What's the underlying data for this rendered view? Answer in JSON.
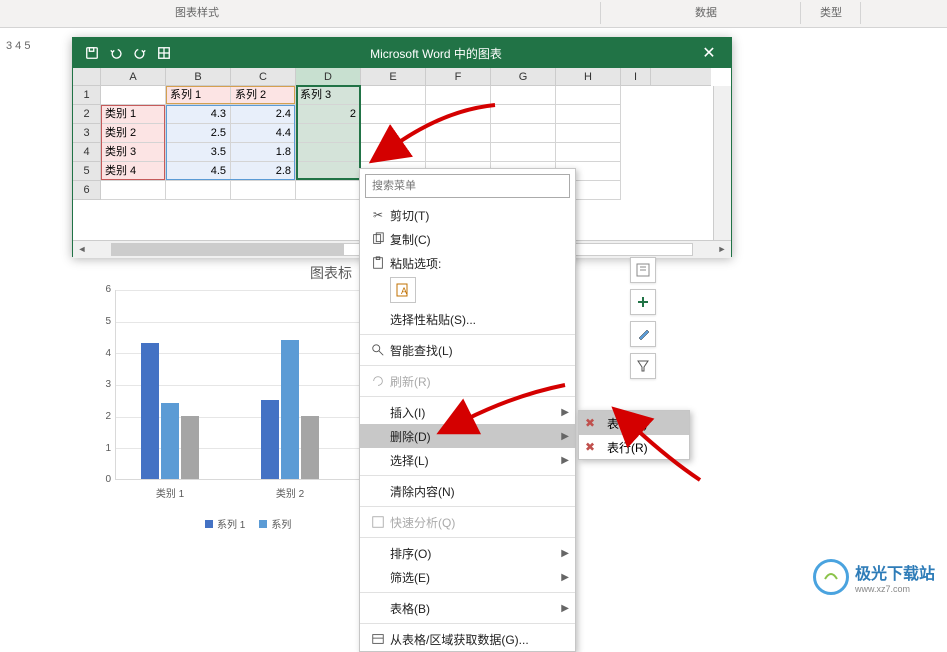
{
  "ribbon": {
    "style_group": "图表样式",
    "data_group": "数据",
    "type_group": "类型"
  },
  "row_tabs": "3     4     5",
  "excel": {
    "title": "Microsoft Word 中的图表",
    "cols": [
      "A",
      "B",
      "C",
      "D",
      "E",
      "F",
      "G",
      "H",
      "I"
    ],
    "rows": [
      "1",
      "2",
      "3",
      "4",
      "5",
      "6"
    ],
    "headers": {
      "s1": "系列 1",
      "s2": "系列 2",
      "s3": "系列 3"
    },
    "cats": {
      "c1": "类别 1",
      "c2": "类别 2",
      "c3": "类别 3",
      "c4": "类别 4"
    },
    "data": {
      "r1": {
        "b": "4.3",
        "c": "2.4",
        "d": "2"
      },
      "r2": {
        "b": "2.5",
        "c": "4.4",
        "d": ""
      },
      "r3": {
        "b": "3.5",
        "c": "1.8",
        "d": ""
      },
      "r4": {
        "b": "4.5",
        "c": "2.8",
        "d": ""
      }
    }
  },
  "chart_title_fragment": "图表标",
  "chart_data": {
    "type": "bar",
    "categories": [
      "类别 1",
      "类别 2",
      "类别 3",
      "类别 4"
    ],
    "series": [
      {
        "name": "系列 1",
        "values": [
          4.3,
          2.5,
          3.5,
          4.5
        ],
        "color": "#4472c4"
      },
      {
        "name": "系列 2",
        "values": [
          2.4,
          4.4,
          1.8,
          2.8
        ],
        "color": "#5b9bd5"
      },
      {
        "name": "系列 3",
        "values": [
          2,
          null,
          null,
          null
        ],
        "color": "#a5a5a5"
      }
    ],
    "ylim": [
      0,
      6
    ],
    "yticks": [
      0,
      1,
      2,
      3,
      4,
      5,
      6
    ],
    "visible_categories": [
      "类别 1",
      "类别 2"
    ],
    "legend_visible": [
      "系列 1",
      "系列"
    ]
  },
  "menu": {
    "search_placeholder": "搜索菜单",
    "cut": "剪切(T)",
    "copy": "复制(C)",
    "paste_opts": "粘贴选项:",
    "paste_special": "选择性粘贴(S)...",
    "smart_lookup": "智能查找(L)",
    "refresh": "刷新(R)",
    "insert": "插入(I)",
    "delete": "删除(D)",
    "select": "选择(L)",
    "clear": "清除内容(N)",
    "quick": "快速分析(Q)",
    "sort": "排序(O)",
    "filter": "筛选(E)",
    "table": "表格(B)",
    "from_table": "从表格/区域获取数据(G)..."
  },
  "submenu": {
    "cols": "表列(C)",
    "rows": "表行(R)"
  },
  "watermark": {
    "brand": "极光下载站",
    "url": "www.xz7.com"
  }
}
